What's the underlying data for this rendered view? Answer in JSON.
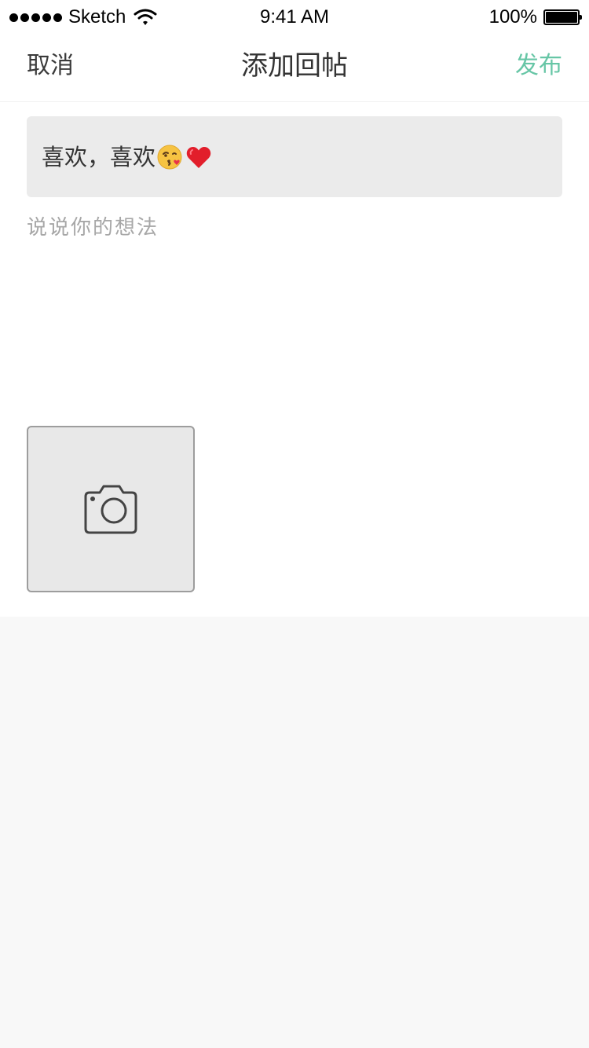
{
  "status_bar": {
    "carrier": "Sketch",
    "time": "9:41 AM",
    "battery": "100%",
    "battery_level": 1.0
  },
  "nav": {
    "cancel_label": "取消",
    "title": "添加回帖",
    "publish_label": "发布",
    "publish_color": "#67c6a6"
  },
  "quote": {
    "text": "喜欢，喜欢",
    "emojis": [
      "kissing-face-icon",
      "red-heart-icon"
    ]
  },
  "composer": {
    "placeholder": "说说你的想法"
  },
  "photo_picker": {
    "icon": "camera-icon"
  },
  "colors": {
    "accent": "#67c6a6",
    "page_background": "#f8f8f8",
    "quote_background": "#ebebeb"
  }
}
